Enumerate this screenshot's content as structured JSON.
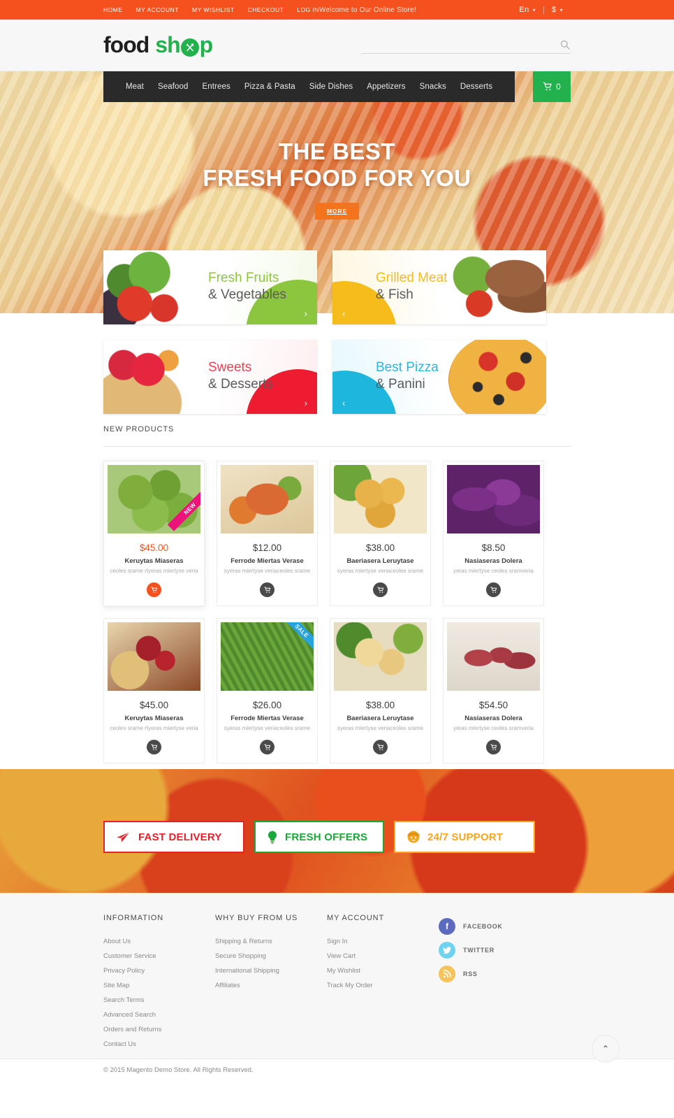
{
  "topbar": {
    "links": [
      {
        "label": "HOME"
      },
      {
        "label": "MY ACCOUNT"
      },
      {
        "label": "MY WISHLIST"
      },
      {
        "label": "CHECKOUT"
      },
      {
        "label": "LOG IN"
      }
    ],
    "welcome": "Welcome to Our Online Store!",
    "language": "En",
    "currency": "$",
    "bg_color": "#f4511e"
  },
  "header": {
    "logo": {
      "part1": "food",
      "part2": "sh",
      "part3": "p",
      "accent_color": "#22b14c"
    },
    "search": {
      "placeholder": "",
      "value": ""
    }
  },
  "nav": {
    "items": [
      {
        "label": "Meat"
      },
      {
        "label": "Seafood"
      },
      {
        "label": "Entrees"
      },
      {
        "label": "Pizza & Pasta"
      },
      {
        "label": "Side Dishes"
      },
      {
        "label": "Appetizers"
      },
      {
        "label": "Snacks"
      },
      {
        "label": "Desserts"
      }
    ],
    "cart_count": "0",
    "cart_color": "#22b14c"
  },
  "hero": {
    "title_line1": "THE BEST",
    "title_line2": "FRESH FOOD FOR YOU",
    "button": "MORE",
    "slides": 3,
    "active_slide": 1
  },
  "categories": [
    {
      "title": "Fresh Fruits",
      "subtitle": "& Vegetables",
      "color": "#8cc63f",
      "arrow": "›",
      "side": "right"
    },
    {
      "title": "Grilled Meat",
      "subtitle": "& Fish",
      "color": "#f5bc1c",
      "arrow": "‹",
      "side": "left"
    },
    {
      "title": "Sweets",
      "subtitle": "& Desserts",
      "color": "#ef4056",
      "arrow": "›",
      "side": "right"
    },
    {
      "title": "Best Pizza",
      "subtitle": "& Panini",
      "color": "#29b8e0",
      "arrow": "‹",
      "side": "left"
    }
  ],
  "products": {
    "section_title": "NEW PRODUCTS",
    "items": [
      {
        "price": "$45.00",
        "name": "Keruytas Miaseras",
        "desc": "ceoles srame rtyeras miertyse veria",
        "badge": "NEW",
        "badge_type": "new",
        "highlighted": true
      },
      {
        "price": "$12.00",
        "name": "Ferrode Miertas Verase",
        "desc": "syeras miertyse veriaceoles srame",
        "badge": "",
        "badge_type": "",
        "highlighted": false
      },
      {
        "price": "$38.00",
        "name": "Baeriasera Leruytase",
        "desc": "syeras miertyse veriaceoles srame",
        "badge": "",
        "badge_type": "",
        "highlighted": false
      },
      {
        "price": "$8.50",
        "name": "Nasiaseras Dolera",
        "desc": "yeras miertyse ceoles sramveria",
        "badge": "",
        "badge_type": "",
        "highlighted": false
      },
      {
        "price": "$45.00",
        "name": "Keruytas Miaseras",
        "desc": "ceoles srame rtyeras miertyse veria",
        "badge": "",
        "badge_type": "",
        "highlighted": false
      },
      {
        "price": "$26.00",
        "name": "Ferrode Miertas Verase",
        "desc": "syeras miertyse veriaceoles srame",
        "badge": "SALE",
        "badge_type": "sale",
        "highlighted": false
      },
      {
        "price": "$38.00",
        "name": "Baeriasera Leruytase",
        "desc": "syeras miertyse veriaceoles srame",
        "badge": "",
        "badge_type": "",
        "highlighted": false
      },
      {
        "price": "$54.50",
        "name": "Nasiaseras Dolera",
        "desc": "yeras miertyse ceoles sramveria",
        "badge": "",
        "badge_type": "",
        "highlighted": false
      }
    ]
  },
  "features": [
    {
      "label": "FAST DELIVERY",
      "color": "#e4202d",
      "icon": "paper-plane-icon"
    },
    {
      "label": "FRESH OFFERS",
      "color": "#19a839",
      "icon": "lightbulb-icon"
    },
    {
      "label": "24/7 SUPPORT",
      "color": "#f5a51e",
      "icon": "support-agent-icon"
    }
  ],
  "footer": {
    "columns": [
      {
        "title": "INFORMATION",
        "links": [
          "About Us",
          "Customer Service",
          "Privacy Policy",
          "Site Map",
          "Search Terms",
          "Advanced Search",
          "Orders and Returns",
          "Contact Us"
        ]
      },
      {
        "title": "WHY BUY FROM US",
        "links": [
          "Shipping & Returns",
          "Secure Shopping",
          "International Shipping",
          "Affiliates"
        ]
      },
      {
        "title": "MY ACCOUNT",
        "links": [
          "Sign In",
          "View Cart",
          "My Wishlist",
          "Track My Order"
        ]
      }
    ],
    "social": [
      {
        "label": "FACEBOOK",
        "glyph": "f",
        "color": "#5c6bc0",
        "cls": "fb"
      },
      {
        "label": "TWITTER",
        "glyph": "ᵗ",
        "color": "#6fd3ef",
        "cls": "tw"
      },
      {
        "label": "RSS",
        "glyph": "◔",
        "color": "#f6c358",
        "cls": "rs"
      }
    ],
    "copyright": "© 2015 Magento Demo Store. All Rights Reserved.",
    "to_top": "⌃"
  }
}
